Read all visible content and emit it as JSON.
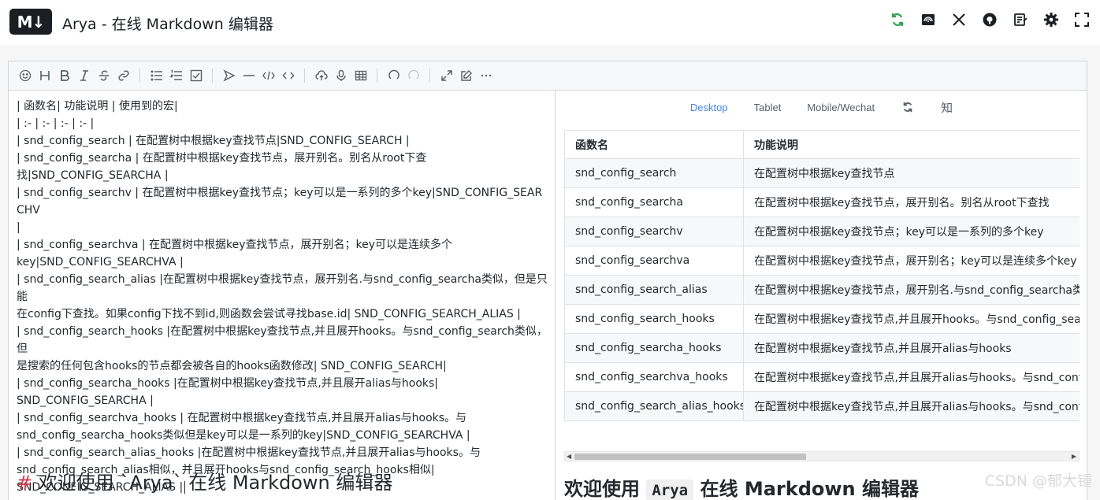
{
  "header": {
    "logo_text": "M↓",
    "title": "Arya - 在线 Markdown 编辑器",
    "icons": [
      "sync-icon",
      "cnblogs-icon",
      "x-icon",
      "github-icon",
      "notes-icon",
      "settings-icon",
      "fullscreen-icon"
    ]
  },
  "toolbar": {
    "groups": [
      [
        "emoji-icon",
        "heading-icon",
        "bold-icon",
        "italic-icon",
        "strike-icon",
        "link-icon"
      ],
      [
        "list-icon",
        "ordered-list-icon",
        "check-icon"
      ],
      [
        "quote-icon",
        "line-icon",
        "code-icon",
        "inline-code-icon"
      ],
      [
        "upload-icon",
        "record-icon",
        "table-icon"
      ],
      [
        "undo-icon",
        "redo-icon"
      ],
      [
        "fullscreen-icon",
        "edit-mode-icon",
        "more-icon"
      ]
    ]
  },
  "source": {
    "lines": [
      "| 函数名| 功能说明 | 使用到的宏|",
      "| :- | :- | :- | :- |",
      "| snd_config_search | 在配置树中根据key查找节点|SND_CONFIG_SEARCH |",
      "| snd_config_searcha | 在配置树中根据key查找节点，展开别名。别名从root下查",
      "找|SND_CONFIG_SEARCHA |",
      "| snd_config_searchv | 在配置树中根据key查找节点；key可以是一系列的多个key|SND_CONFIG_SEARCHV",
      "|",
      "| snd_config_searchva | 在配置树中根据key查找节点，展开别名；key可以是连续多个",
      "key|SND_CONFIG_SEARCHVA |",
      "| snd_config_search_alias |在配置树中根据key查找节点，展开别名.与snd_config_searcha类似，但是只能",
      "在config下查找。如果config下找不到id,则函数会尝试寻找base.id| SND_CONFIG_SEARCH_ALIAS |",
      "| snd_config_search_hooks |在配置树中根据key查找节点,并且展开hooks。与snd_config_search类似，但",
      "是搜索的任何包含hooks的节点都会被各自的hooks函数修改| SND_CONFIG_SEARCH|",
      "| snd_config_searcha_hooks |在配置树中根据key查找节点,并且展开alias与hooks|",
      "SND_CONFIG_SEARCHA |",
      "| snd_config_searchva_hooks | 在配置树中根据key查找节点,并且展开alias与hooks。与",
      "snd_config_searcha_hooks类似但是key可以是一系列的key|SND_CONFIG_SEARCHVA |",
      "| snd_config_search_alias_hooks |在配置树中根据key查找节点,并且展开alias与hooks。与",
      "snd_config_search_alias相似，并且展开hooks与snd_config_search_hooks相似|",
      "SND_CONFIG_SEARCH_ALIAS |"
    ],
    "heading_hash": "#",
    "heading_text": "欢迎使用 `Arya` 在线 Markdown 编辑器"
  },
  "preview": {
    "tabs": [
      "Desktop",
      "Tablet",
      "Mobile/Wechat"
    ],
    "active_tab": "Desktop",
    "zhi_label": "知",
    "table": {
      "headers": [
        "函数名",
        "功能说明"
      ],
      "rows": [
        [
          "snd_config_search",
          "在配置树中根据key查找节点"
        ],
        [
          "snd_config_searcha",
          "在配置树中根据key查找节点，展开别名。别名从root下查找"
        ],
        [
          "snd_config_searchv",
          "在配置树中根据key查找节点；key可以是一系列的多个key"
        ],
        [
          "snd_config_searchva",
          "在配置树中根据key查找节点，展开别名；key可以是连续多个key"
        ],
        [
          "snd_config_search_alias",
          "在配置树中根据key查找节点，展开别名.与snd_config_searcha类似"
        ],
        [
          "snd_config_search_hooks",
          "在配置树中根据key查找节点,并且展开hooks。与snd_config_search类似"
        ],
        [
          "snd_config_searcha_hooks",
          "在配置树中根据key查找节点,并且展开alias与hooks"
        ],
        [
          "snd_config_searchva_hooks",
          "在配置树中根据key查找节点,并且展开alias与hooks。与snd_config_searcha_hooks"
        ],
        [
          "snd_config_search_alias_hooks",
          "在配置树中根据key查找节点,并且展开alias与hooks。与snd_config_search_alias"
        ]
      ]
    },
    "heading_before": "欢迎使用",
    "heading_code": "Arya",
    "heading_after": "在线 Markdown 编辑器"
  },
  "watermark": "CSDN @郁大锺"
}
